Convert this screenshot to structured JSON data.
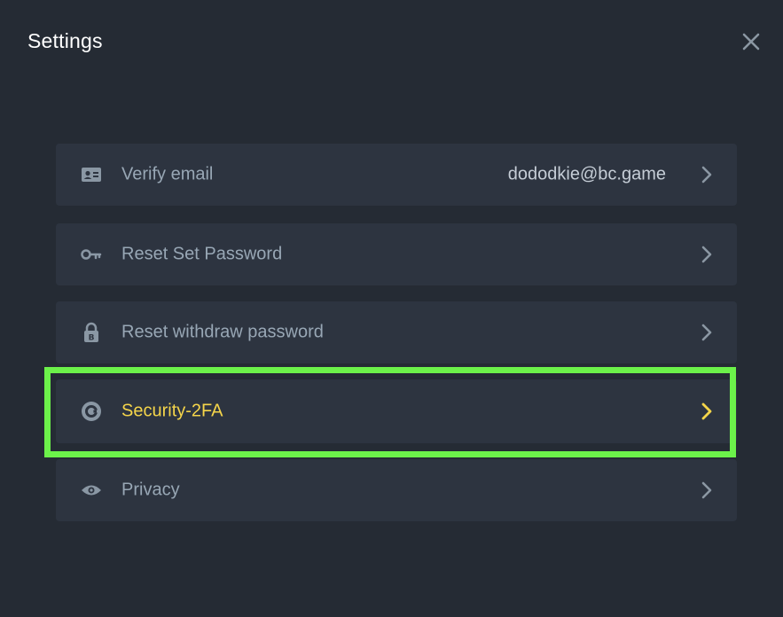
{
  "dialog": {
    "title": "Settings",
    "close_icon": "close-icon"
  },
  "settings": {
    "items": [
      {
        "label": "Verify email",
        "value": "dododkie@bc.game",
        "icon": "id-card-icon"
      },
      {
        "label": "Reset Set Password",
        "value": "",
        "icon": "key-icon"
      },
      {
        "label": "Reset withdraw password",
        "value": "",
        "icon": "lock-icon"
      },
      {
        "label": "Security-2FA",
        "value": "",
        "icon": "google-auth-icon"
      },
      {
        "label": "Privacy",
        "value": "",
        "icon": "eye-icon"
      }
    ]
  },
  "colors": {
    "background": "#252b34",
    "row": "#2d3440",
    "label": "#98a7b5",
    "active_label": "#f5d54a",
    "highlight": "#6cf24a"
  }
}
